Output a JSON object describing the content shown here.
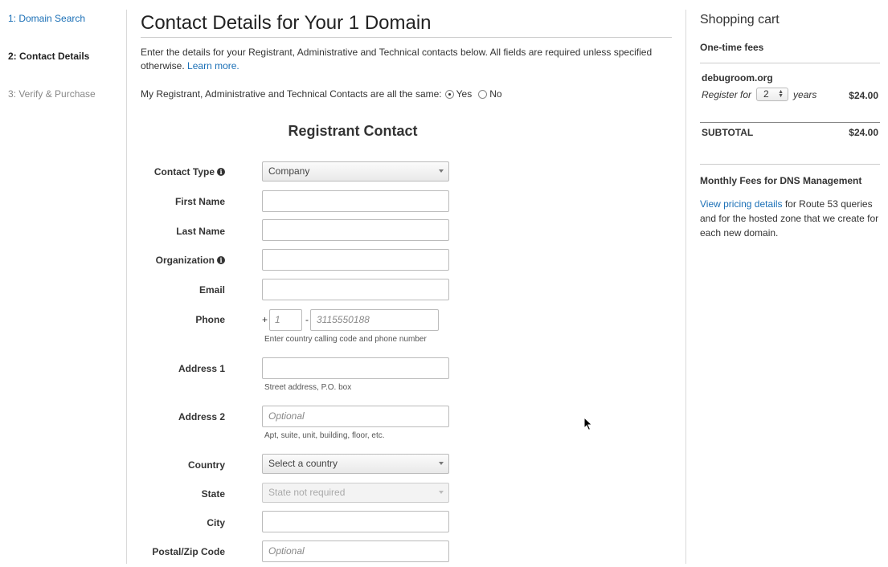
{
  "steps": [
    {
      "label": "1: Domain Search",
      "state": "link"
    },
    {
      "label": "2: Contact Details",
      "state": "active"
    },
    {
      "label": "3: Verify & Purchase",
      "state": "disabled"
    }
  ],
  "main": {
    "title": "Contact Details for Your 1 Domain",
    "intro_text": "Enter the details for your Registrant, Administrative and Technical contacts below. All fields are required unless specified otherwise.",
    "learn_more": "Learn more.",
    "same_contacts_label": "My Registrant, Administrative and Technical Contacts are all the same:",
    "yes_label": "Yes",
    "no_label": "No",
    "section_title": "Registrant Contact"
  },
  "form": {
    "contact_type": {
      "label": "Contact Type",
      "value": "Company"
    },
    "first_name": {
      "label": "First Name",
      "value": ""
    },
    "last_name": {
      "label": "Last Name",
      "value": ""
    },
    "organization": {
      "label": "Organization",
      "value": ""
    },
    "email": {
      "label": "Email",
      "value": ""
    },
    "phone": {
      "label": "Phone",
      "plus": "+",
      "code_placeholder": "1",
      "separator": "-",
      "number_placeholder": "3115550188",
      "help": "Enter country calling code and phone number"
    },
    "address1": {
      "label": "Address 1",
      "value": "",
      "help": "Street address, P.O. box"
    },
    "address2": {
      "label": "Address 2",
      "placeholder": "Optional",
      "help": "Apt, suite, unit, building, floor, etc."
    },
    "country": {
      "label": "Country",
      "value": "Select a country"
    },
    "state": {
      "label": "State",
      "value": "State not required"
    },
    "city": {
      "label": "City",
      "value": ""
    },
    "postal": {
      "label": "Postal/Zip Code",
      "placeholder": "Optional"
    }
  },
  "cart": {
    "title": "Shopping cart",
    "one_time_fees": "One-time fees",
    "domain": "debugroom.org",
    "register_for": "Register for",
    "years_value": "2",
    "years_label": "years",
    "domain_price": "$24.00",
    "subtotal_label": "SUBTOTAL",
    "subtotal_price": "$24.00",
    "monthly_title": "Monthly Fees for DNS Management",
    "pricing_link": "View pricing details",
    "monthly_text": " for Route 53 queries and for the hosted zone that we create for each new domain."
  },
  "icons": {
    "info": "info-circle-icon",
    "caret": "caret-down-icon",
    "cursor": "mouse-pointer-icon"
  },
  "colors": {
    "link": "#1a6fb6",
    "text": "#333333",
    "border": "#bbbbbb"
  }
}
